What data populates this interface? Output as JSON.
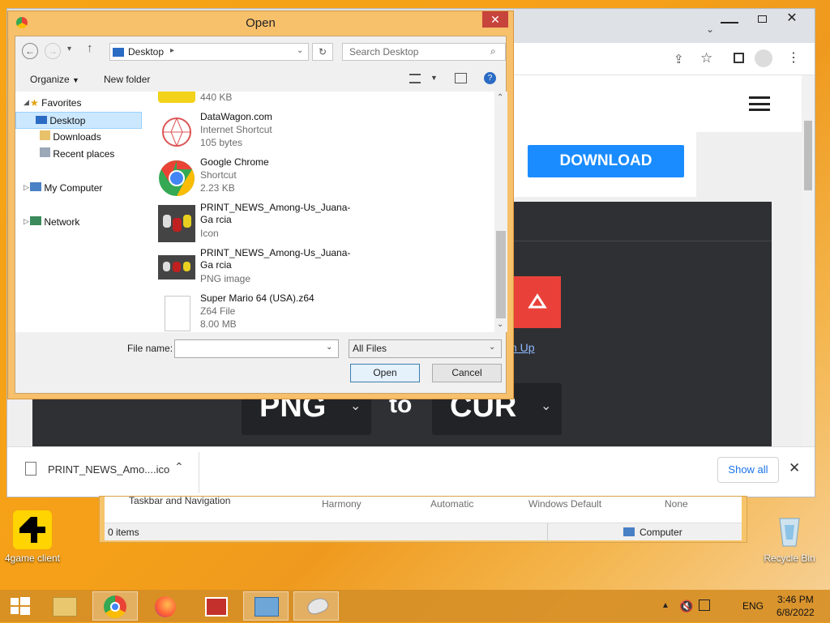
{
  "dialog": {
    "title": "Open",
    "address": "Desktop",
    "search_placeholder": "Search Desktop",
    "organize_label": "Organize",
    "new_folder_label": "New folder",
    "nav": {
      "favorites": "Favorites",
      "desktop": "Desktop",
      "downloads": "Downloads",
      "recent_places": "Recent places",
      "my_computer": "My Computer",
      "network": "Network"
    },
    "files": [
      {
        "name": "",
        "type": "",
        "size": "440 KB"
      },
      {
        "name": "DataWagon.com",
        "type": "Internet Shortcut",
        "size": "105 bytes"
      },
      {
        "name": "Google Chrome",
        "type": "Shortcut",
        "size": "2.23 KB"
      },
      {
        "name": "PRINT_NEWS_Among-Us_Juana-Ga rcia",
        "type": "Icon",
        "size": ""
      },
      {
        "name": "PRINT_NEWS_Among-Us_Juana-Ga rcia",
        "type": "PNG image",
        "size": ""
      },
      {
        "name": "Super Mario 64 (USA).z64",
        "type": "Z64 File",
        "size": "8.00 MB"
      }
    ],
    "file_name_label": "File name:",
    "file_name_value": "",
    "filter_value": "All Files",
    "open_label": "Open",
    "cancel_label": "Cancel"
  },
  "browser": {
    "download_button": "DOWNLOAD",
    "from_format": "PNG",
    "to_word": "to",
    "to_format": "CUR",
    "signup_fragment": "n Up",
    "download_item": "PRINT_NEWS_Amo....ico",
    "show_all_label": "Show all"
  },
  "explorer_bg": {
    "row_name": "Taskbar and Navigation",
    "col1": "Harmony",
    "col2": "Automatic",
    "col3": "Windows Default",
    "col4": "None",
    "status_items": "0 items",
    "status_location": "Computer"
  },
  "desktop": {
    "icon_4game": "4game client",
    "icon_recycle": "Recycle Bin"
  },
  "taskbar": {
    "lang": "ENG",
    "time": "3:46 PM",
    "date": "6/8/2022"
  },
  "colors": {
    "accent_blue": "#1a8cff",
    "dialog_frame": "#f7c06b",
    "download_red": "#e9413a"
  }
}
